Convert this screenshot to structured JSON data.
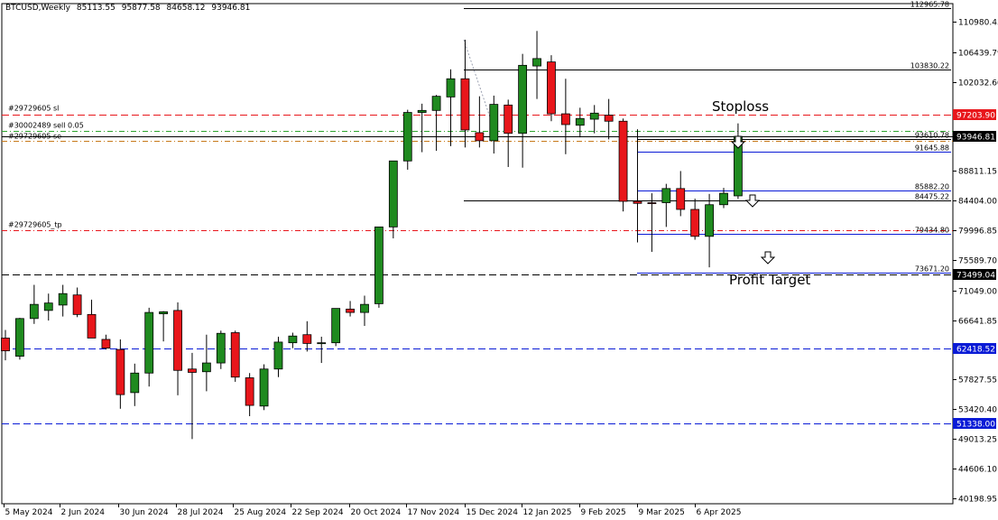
{
  "header": {
    "symbol": "BTCUSD,Weekly",
    "open": "85113.55",
    "high": "95877.58",
    "low": "84658.12",
    "close": "93946.81"
  },
  "colors": {
    "bull": "#1f8a1f",
    "bear": "#e8161b",
    "grid_axis": "#000000",
    "red_line": "#e8161b",
    "blue_line": "#0a1bd6",
    "green_line": "#2ea32e",
    "price_tag": "#000000"
  },
  "chart_data": {
    "type": "candlestick",
    "title": "BTCUSD,Weekly",
    "y_ticks": [
      "110980.45",
      "106439.79",
      "102032.60",
      "88811.15",
      "84404.00",
      "79996.85",
      "75589.70",
      "71049.00",
      "66641.85",
      "57827.55",
      "53420.40",
      "49013.25",
      "44606.10",
      "40198.95"
    ],
    "x_ticks": [
      "5 May 2024",
      "2 Jun 2024",
      "30 Jun 2024",
      "28 Jul 2024",
      "25 Aug 2024",
      "22 Sep 2024",
      "20 Oct 2024",
      "17 Nov 2024",
      "15 Dec 2024",
      "12 Jan 2025",
      "9 Feb 2025",
      "9 Mar 2025",
      "6 Apr 2025"
    ],
    "candles": [
      {
        "o": 64000,
        "h": 65200,
        "l": 60700,
        "c": 62100
      },
      {
        "o": 61300,
        "h": 67000,
        "l": 60800,
        "c": 66900
      },
      {
        "o": 66900,
        "h": 71900,
        "l": 66100,
        "c": 69000
      },
      {
        "o": 68100,
        "h": 70600,
        "l": 66600,
        "c": 69200
      },
      {
        "o": 68900,
        "h": 71900,
        "l": 67200,
        "c": 70600
      },
      {
        "o": 70400,
        "h": 71500,
        "l": 67100,
        "c": 67500
      },
      {
        "o": 67500,
        "h": 69700,
        "l": 65000,
        "c": 64000
      },
      {
        "o": 63800,
        "h": 64500,
        "l": 62300,
        "c": 62500
      },
      {
        "o": 62300,
        "h": 63800,
        "l": 53500,
        "c": 55600
      },
      {
        "o": 55900,
        "h": 60200,
        "l": 53900,
        "c": 58800
      },
      {
        "o": 58800,
        "h": 68500,
        "l": 56800,
        "c": 67800
      },
      {
        "o": 67600,
        "h": 68000,
        "l": 63500,
        "c": 67900
      },
      {
        "o": 68100,
        "h": 69300,
        "l": 55500,
        "c": 59200
      },
      {
        "o": 59400,
        "h": 61800,
        "l": 49000,
        "c": 58900
      },
      {
        "o": 59000,
        "h": 64500,
        "l": 56100,
        "c": 60300
      },
      {
        "o": 60300,
        "h": 65100,
        "l": 59400,
        "c": 64700
      },
      {
        "o": 64800,
        "h": 65100,
        "l": 57500,
        "c": 58200
      },
      {
        "o": 58100,
        "h": 58800,
        "l": 52400,
        "c": 54000
      },
      {
        "o": 53900,
        "h": 60100,
        "l": 53300,
        "c": 59400
      },
      {
        "o": 59400,
        "h": 64200,
        "l": 58200,
        "c": 63400
      },
      {
        "o": 63300,
        "h": 64800,
        "l": 62500,
        "c": 64300
      },
      {
        "o": 64500,
        "h": 66500,
        "l": 62000,
        "c": 63200
      },
      {
        "o": 63300,
        "h": 64200,
        "l": 60300,
        "c": 63300
      },
      {
        "o": 63300,
        "h": 66900,
        "l": 62800,
        "c": 68400
      },
      {
        "o": 68300,
        "h": 69500,
        "l": 67200,
        "c": 67800
      },
      {
        "o": 67800,
        "h": 70300,
        "l": 65800,
        "c": 69000
      },
      {
        "o": 69100,
        "h": 73600,
        "l": 68500,
        "c": 80500
      },
      {
        "o": 80500,
        "h": 88900,
        "l": 78800,
        "c": 90300
      },
      {
        "o": 90300,
        "h": 97900,
        "l": 89000,
        "c": 97500
      },
      {
        "o": 97500,
        "h": 98800,
        "l": 91600,
        "c": 97800
      },
      {
        "o": 97800,
        "h": 100100,
        "l": 91800,
        "c": 99900
      },
      {
        "o": 99800,
        "h": 103900,
        "l": 92500,
        "c": 102500
      },
      {
        "o": 102500,
        "h": 108300,
        "l": 92300,
        "c": 94900
      },
      {
        "o": 94500,
        "h": 99900,
        "l": 92300,
        "c": 93300
      },
      {
        "o": 93300,
        "h": 100000,
        "l": 91400,
        "c": 98700
      },
      {
        "o": 98600,
        "h": 99400,
        "l": 89400,
        "c": 94400
      },
      {
        "o": 94400,
        "h": 106200,
        "l": 89300,
        "c": 104500
      },
      {
        "o": 104400,
        "h": 109600,
        "l": 99500,
        "c": 105500
      },
      {
        "o": 105000,
        "h": 106000,
        "l": 96200,
        "c": 97300
      },
      {
        "o": 97300,
        "h": 102500,
        "l": 91300,
        "c": 95700
      },
      {
        "o": 95600,
        "h": 98200,
        "l": 93800,
        "c": 96600
      },
      {
        "o": 96500,
        "h": 98600,
        "l": 94400,
        "c": 97400
      },
      {
        "o": 97100,
        "h": 99500,
        "l": 93500,
        "c": 96200
      },
      {
        "o": 96200,
        "h": 96600,
        "l": 82800,
        "c": 84300
      },
      {
        "o": 84300,
        "h": 95000,
        "l": 78200,
        "c": 84000
      },
      {
        "o": 84100,
        "h": 85500,
        "l": 76800,
        "c": 84000
      },
      {
        "o": 84100,
        "h": 86900,
        "l": 80500,
        "c": 86200
      },
      {
        "o": 86200,
        "h": 88800,
        "l": 82100,
        "c": 83100
      },
      {
        "o": 83100,
        "h": 84700,
        "l": 78600,
        "c": 79100
      },
      {
        "o": 79100,
        "h": 85400,
        "l": 74500,
        "c": 83800
      },
      {
        "o": 83800,
        "h": 86300,
        "l": 83300,
        "c": 85500
      },
      {
        "o": 85113.55,
        "h": 95877.58,
        "l": 84658.12,
        "c": 93946.81
      }
    ]
  },
  "levels": {
    "red_dashed": [
      {
        "value": 97203.9,
        "label": "#29729605 sl",
        "tag": "97203.90"
      }
    ],
    "sell_line": {
      "label": "#30002489 sell 0.05"
    },
    "green_dashdot": {
      "value": 94700
    },
    "entry_line": {
      "label": "#29729605 se"
    },
    "orange_dashdot": {
      "value": 93300
    },
    "tp_line": {
      "value": 80000,
      "label": "#29729605_tp"
    },
    "black_dashed": {
      "value": 73499.04,
      "tag": "73499.04"
    },
    "blue_dashed": [
      {
        "value": 62418.52,
        "tag": "62418.52"
      },
      {
        "value": 51338.0,
        "tag": "51338.00"
      }
    ],
    "current_price": {
      "value": 93946.81,
      "tag": "93946.81"
    }
  },
  "fib_levels": [
    {
      "value": 112965.78,
      "label": "112965.78",
      "color": "#000000"
    },
    {
      "value": 103830.22,
      "label": "103830.22",
      "color": "#000000"
    },
    {
      "value": 93610.78,
      "label": "93610.78",
      "color": "#000000"
    },
    {
      "value": 91645.88,
      "label": "91645.88",
      "color": "#0a1bd6"
    },
    {
      "value": 85882.2,
      "label": "85882.20",
      "color": "#0a1bd6"
    },
    {
      "value": 84475.22,
      "label": "84475.22",
      "color": "#000000"
    },
    {
      "value": 79434.8,
      "label": "79434.80",
      "color": "#0a1bd6"
    },
    {
      "value": 73671.2,
      "label": "73671.20",
      "color": "#0a1bd6"
    }
  ],
  "annotations": {
    "stoploss": "Stoploss",
    "profit_target": "Profit Target"
  },
  "icons": {
    "down_arrow": "down-arrow-icon"
  }
}
